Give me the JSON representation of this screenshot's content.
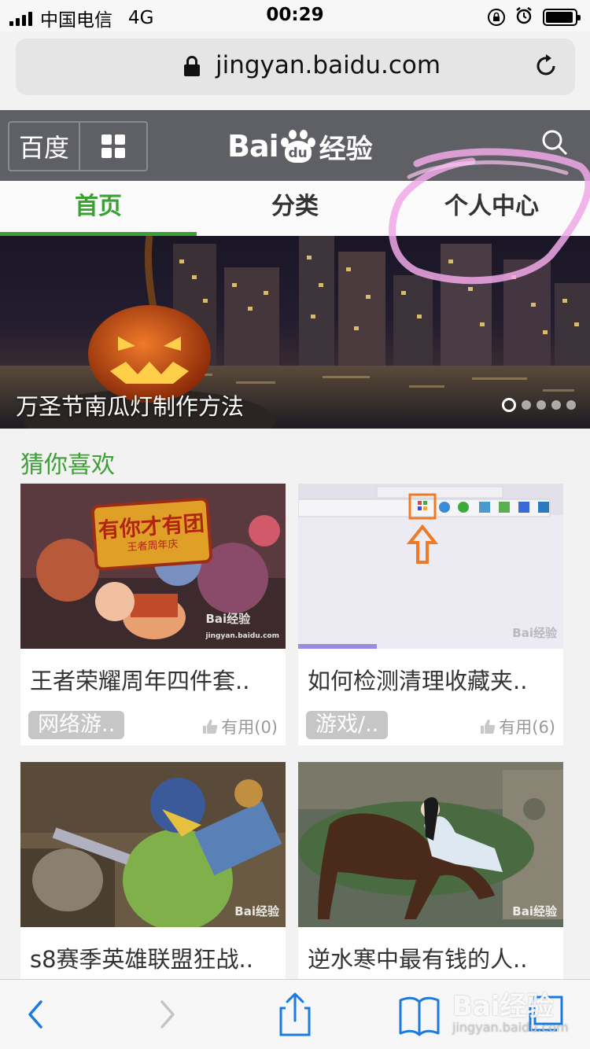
{
  "status_bar": {
    "carrier": "中国电信",
    "network": "4G",
    "time": "00:29"
  },
  "address_bar": {
    "url": "jingyan.baidu.com"
  },
  "header": {
    "baidu_label": "百度",
    "logo_text": "Bai",
    "logo_paw_text": "du",
    "logo_suffix": "经验"
  },
  "nav": {
    "tabs": [
      {
        "label": "首页"
      },
      {
        "label": "分类"
      },
      {
        "label": "个人中心"
      }
    ],
    "active_color": "#3ca035"
  },
  "banner": {
    "caption": "万圣节南瓜灯制作方法",
    "slide_count": 5,
    "active_slide": 1
  },
  "recommendations": {
    "title": "猜你喜欢",
    "cards": [
      {
        "title": "王者荣耀周年四件套..",
        "tag": "网络游..",
        "useful": "有用(0)",
        "image_text": "有你才有团",
        "image_subtext": "王者周年庆"
      },
      {
        "title": "如何检测清理收藏夹..",
        "tag": "游戏/..",
        "useful": "有用(6)"
      },
      {
        "title": "s8赛季英雄联盟狂战.."
      },
      {
        "title": "逆水寒中最有钱的人.."
      }
    ]
  },
  "watermark": {
    "text": "Bai经验",
    "url": "jingyan.baidu.com"
  }
}
